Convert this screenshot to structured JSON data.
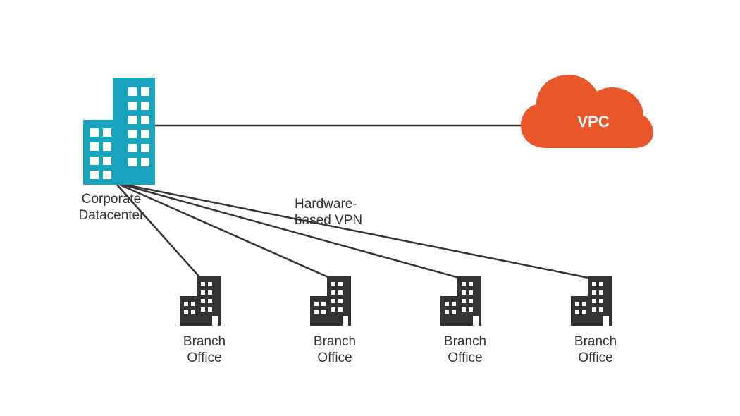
{
  "diagram": {
    "datacenter": {
      "label1": "Corporate",
      "label2": "Datacenter"
    },
    "cloud": {
      "label": "VPC"
    },
    "link": {
      "label1": "Hardware-",
      "label2": "based VPN"
    },
    "branches": [
      {
        "label1": "Branch",
        "label2": "Office"
      },
      {
        "label1": "Branch",
        "label2": "Office"
      },
      {
        "label1": "Branch",
        "label2": "Office"
      },
      {
        "label1": "Branch",
        "label2": "Office"
      }
    ]
  },
  "colors": {
    "teal": "#1AA3BC",
    "orange": "#E8562A",
    "dark": "#333333",
    "line": "#333333"
  }
}
